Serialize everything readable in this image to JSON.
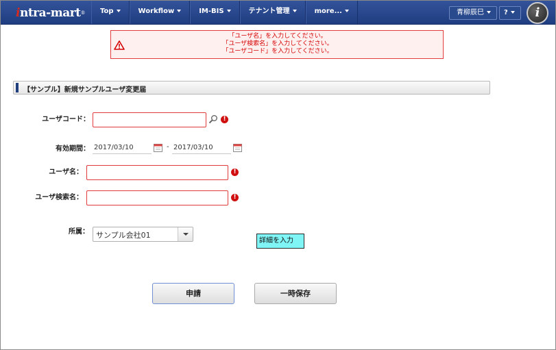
{
  "header": {
    "logo": "intra-mart",
    "nav": [
      {
        "label": "Top"
      },
      {
        "label": "Workflow"
      },
      {
        "label": "IM-BIS"
      },
      {
        "label": "テナント管理"
      },
      {
        "label": "more..."
      }
    ],
    "user_name": "青柳辰巳",
    "help_label": "?",
    "badge_letter": "i"
  },
  "errors": {
    "messages": [
      "「ユーザ名」を入力してください。",
      "「ユーザ検索名」を入力してください。",
      "「ユーザコード」を入力してください。"
    ]
  },
  "section": {
    "title": "【サンプル】新規サンプルユーザ変更届"
  },
  "form": {
    "user_code_label": "ユーザコード：",
    "user_code_value": "",
    "period_label": "有効期間：",
    "period_start": "2017/03/10",
    "period_separator": "-",
    "period_end": "2017/03/10",
    "user_name_label": "ユーザ名：",
    "user_name_value": "",
    "user_search_name_label": "ユーザ検索名：",
    "user_search_name_value": "",
    "affiliation_label": "所属：",
    "affiliation_value": "サンプル会社01",
    "detail_tooltip": "詳細を入力",
    "error_mark": "!"
  },
  "buttons": {
    "apply": "申請",
    "save_draft": "一時保存"
  },
  "colors": {
    "header_bg": "#1f3d80",
    "error_border": "#e23c3c",
    "error_text": "#d40000",
    "tooltip_bg": "#7ff5f5"
  }
}
